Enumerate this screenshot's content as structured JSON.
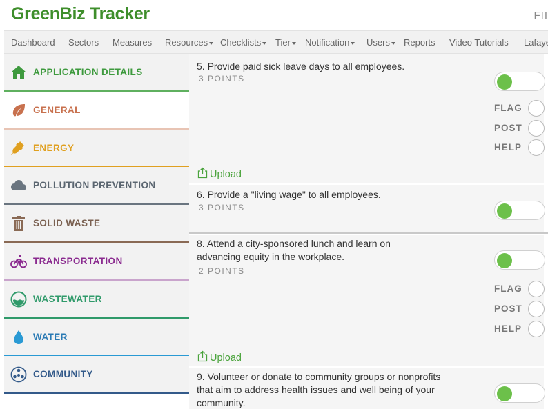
{
  "app": {
    "title": "GreenBiz Tracker",
    "header_right": "FII"
  },
  "nav": {
    "items": [
      {
        "label": "Dashboard",
        "dropdown": false
      },
      {
        "label": "Sectors",
        "dropdown": false
      },
      {
        "label": "Measures",
        "dropdown": false
      },
      {
        "label": "Resources",
        "dropdown": true
      },
      {
        "label": "Checklists",
        "dropdown": true
      },
      {
        "label": "Tier",
        "dropdown": true
      },
      {
        "label": "Notification",
        "dropdown": true
      },
      {
        "label": "Users",
        "dropdown": true
      },
      {
        "label": "Reports",
        "dropdown": false
      },
      {
        "label": "Video Tutorials",
        "dropdown": false
      },
      {
        "label": "Lafaye",
        "dropdown": false
      }
    ]
  },
  "sidebar": {
    "items": [
      {
        "label": "APPLICATION DETAILS",
        "icon": "home-icon",
        "color": "#3e9a3e",
        "active": false
      },
      {
        "label": "GENERAL",
        "icon": "leaf-icon",
        "color": "#c8714e",
        "active": true
      },
      {
        "label": "ENERGY",
        "icon": "plug-icon",
        "color": "#e0a020",
        "active": false
      },
      {
        "label": "POLLUTION PREVENTION",
        "icon": "cloud-icon",
        "color": "#6a7580",
        "active": false
      },
      {
        "label": "SOLID WASTE",
        "icon": "trash-icon",
        "color": "#8a6a55",
        "active": false
      },
      {
        "label": "TRANSPORTATION",
        "icon": "bicycle-icon",
        "color": "#8a2a8f",
        "active": false
      },
      {
        "label": "WASTEWATER",
        "icon": "water-circle-icon",
        "color": "#2f9a6a",
        "active": false
      },
      {
        "label": "WATER",
        "icon": "droplet-icon",
        "color": "#2a9ad4",
        "active": false
      },
      {
        "label": "COMMUNITY",
        "icon": "community-icon",
        "color": "#335a8a",
        "active": false
      }
    ]
  },
  "measures": [
    {
      "text": "5. Provide paid sick leave days to all employees.",
      "points": "3 POINTS",
      "toggle_on": true,
      "show_flags": true,
      "upload": "Upload"
    },
    {
      "text": "6. Provide a \"living wage\" to all employees.",
      "points": "3 POINTS",
      "toggle_on": true
    },
    {
      "text": "8. Attend a city-sponsored lunch and learn on advancing equity in the workplace.",
      "points": "2 POINTS",
      "toggle_on": true,
      "show_flags": true,
      "upload": "Upload"
    },
    {
      "text": "9. Volunteer or donate to community groups or nonprofits that aim to address health issues and well being of your community.",
      "toggle_on": true
    }
  ],
  "flags": {
    "flag": "FLAG",
    "post": "POST",
    "help": "HELP"
  },
  "colors": {
    "brand": "#3e8e2b",
    "toggle_on": "#6cc04a",
    "upload": "#4aa33c"
  }
}
